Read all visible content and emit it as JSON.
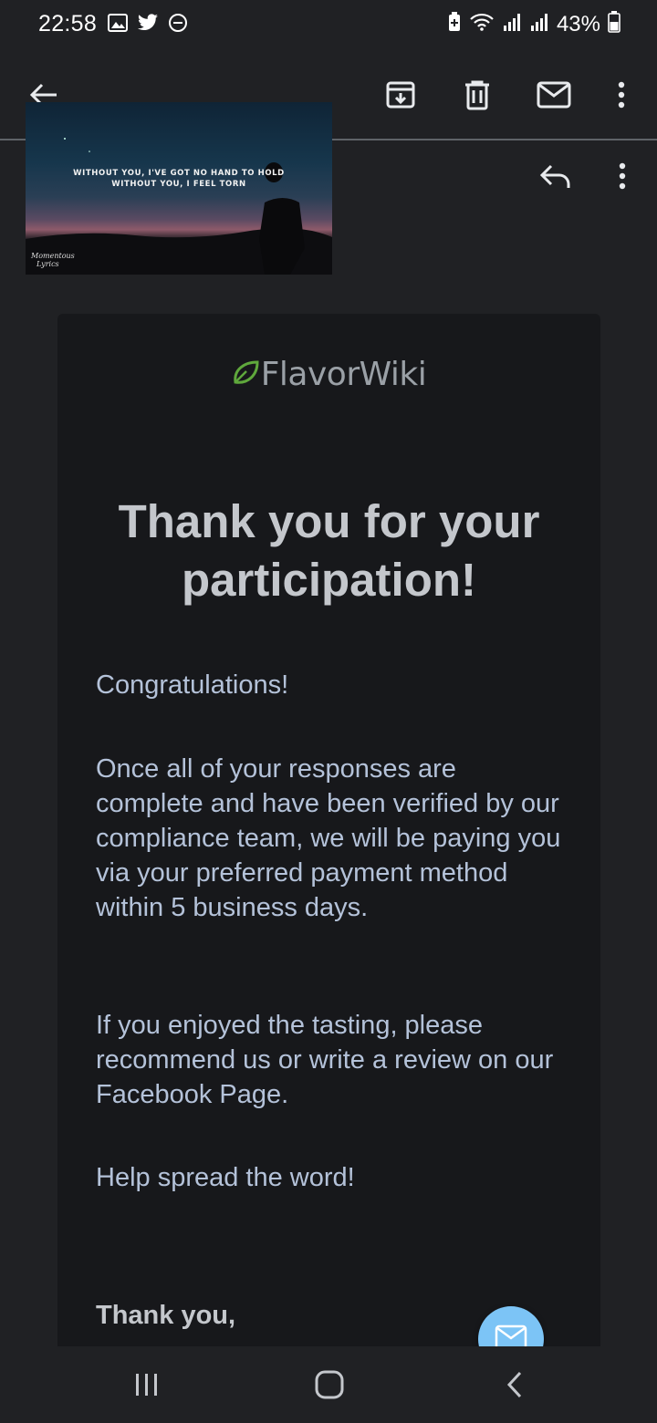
{
  "status_bar": {
    "time": "22:58",
    "battery_percent": "43%",
    "left_icons": [
      "gallery-icon",
      "twitter-icon",
      "do-not-disturb-icon"
    ],
    "right_icons": [
      "battery-saver-icon",
      "wifi-icon",
      "signal-icon",
      "signal-icon",
      "battery-icon"
    ]
  },
  "toolbar": {
    "icons": [
      "back-arrow-icon",
      "archive-icon",
      "delete-icon",
      "mark-unread-icon",
      "more-vert-icon"
    ]
  },
  "thumbnail": {
    "line1": "WITHOUT YOU, I'VE GOT NO HAND TO HOLD",
    "line2": "WITHOUT YOU, I FEEL TORN",
    "signature_line1": "Momentous",
    "signature_line2": "Lyrics"
  },
  "header_actions": {
    "icons": [
      "reply-icon",
      "more-vert-icon"
    ]
  },
  "email": {
    "logo_text": "FlavorWiki",
    "heading": "Thank you for your participation!",
    "paragraphs": [
      "Congratulations!",
      "Once all of your responses are complete and have been verified by our compliance team, we will be paying you via your preferred payment method within 5 business days.",
      "If you enjoyed the tasting, please recommend us or write a review on our Facebook Page.",
      "Help spread the word!"
    ],
    "signoff": "Thank you,"
  },
  "fab": {
    "icon": "compose-mail-icon"
  },
  "nav_bar": {
    "icons": [
      "recent-apps-icon",
      "home-icon",
      "back-icon"
    ]
  },
  "colors": {
    "background": "#202124",
    "card": "#17181b",
    "body_text": "#b4c2d9",
    "heading_text": "#c4c7cc",
    "logo_leaf": "#5fa83c",
    "fab": "#7cc4f6"
  }
}
